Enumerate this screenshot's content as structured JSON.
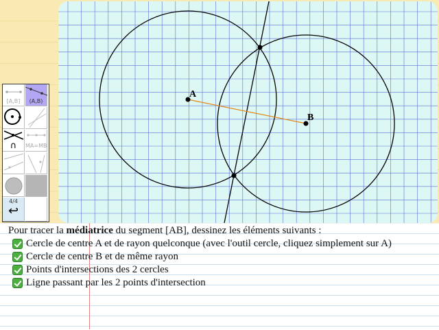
{
  "canvas": {
    "point_a": {
      "label": "A"
    },
    "point_b": {
      "label": "B"
    }
  },
  "toolbox": {
    "segment_label": "[A,B]",
    "line_label": "(A,B)",
    "intersection_label": "∩",
    "equal_distance_label": "MA=MB",
    "page_label": "4/4",
    "undo_label": "↩"
  },
  "instructions": {
    "intro_before": "Pour tracer la ",
    "intro_bold": "médiatrice",
    "intro_after": " du segment [AB], dessinez les éléments suivants :",
    "steps": [
      {
        "text": "Cercle de centre A et de rayon quelconque (avec l'outil cercle, cliquez simplement sur A)",
        "done": true
      },
      {
        "text": "Cercle de centre B et de même rayon",
        "done": true
      },
      {
        "text": "Points d'intersections des 2 cercles",
        "done": true
      },
      {
        "text": "Ligne passant par les 2 points d'intersection",
        "done": true
      }
    ]
  },
  "colors": {
    "canvas_bg": "#dcf7f4",
    "grid": "#5b6fd6",
    "segment": "#e0891c",
    "check": "#4caf3f",
    "active_tool": "#b3a6f2"
  }
}
